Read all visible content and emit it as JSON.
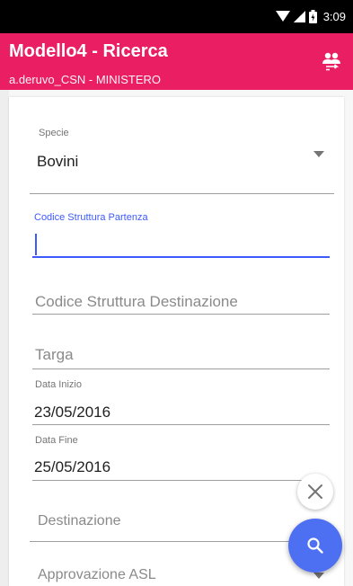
{
  "status_bar": {
    "time": "3:09"
  },
  "app_bar": {
    "title": "Modello4 - Ricerca",
    "subtitle": "a.deruvo_CSN - MINISTERO",
    "action_icon": "people-icon"
  },
  "form": {
    "specie": {
      "label": "Specie",
      "value": "Bovini"
    },
    "codice_partenza": {
      "label": "Codice Struttura Partenza",
      "value": ""
    },
    "codice_destinazione": {
      "placeholder": "Codice Struttura Destinazione"
    },
    "targa": {
      "placeholder": "Targa"
    },
    "data_inizio": {
      "label": "Data Inizio",
      "value": "23/05/2016"
    },
    "data_fine": {
      "label": "Data Fine",
      "value": "25/05/2016"
    },
    "destinazione": {
      "placeholder": "Destinazione"
    },
    "approvazione_asl": {
      "placeholder": "Approvazione ASL"
    }
  },
  "colors": {
    "app_bar": "#e91e63",
    "accent": "#3d5afe",
    "fab": "#4d6ff2"
  }
}
